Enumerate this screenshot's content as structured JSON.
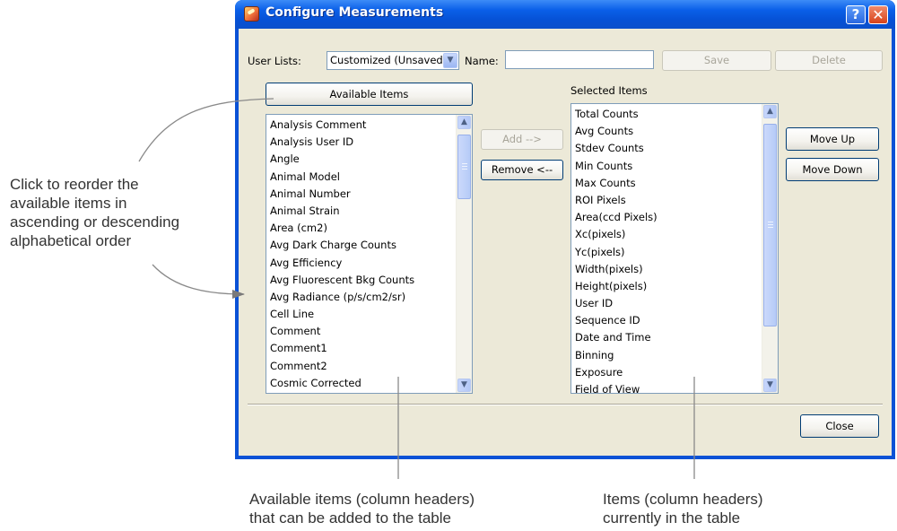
{
  "window": {
    "title": "Configure Measurements",
    "help_label": "?",
    "close_label": "✕"
  },
  "toolbar": {
    "user_lists_label": "User Lists:",
    "user_list_selected": "Customized (Unsaved)",
    "name_label": "Name:",
    "name_value": "",
    "save_label": "Save",
    "delete_label": "Delete"
  },
  "available": {
    "header_button": "Available Items",
    "items": [
      "Analysis Comment",
      "Analysis User ID",
      "Angle",
      "Animal Model",
      "Animal Number",
      "Animal Strain",
      "Area (cm2)",
      "Avg Dark Charge Counts",
      "Avg Efficiency",
      "Avg Fluorescent Bkg Counts",
      "Avg Radiance (p/s/cm2/sr)",
      "Cell Line",
      "Comment",
      "Comment1",
      "Comment2",
      "Cosmic Corrected"
    ]
  },
  "selected": {
    "header": "Selected Items",
    "items": [
      "Total Counts",
      "Avg Counts",
      "Stdev Counts",
      "Min Counts",
      "Max Counts",
      "ROI Pixels",
      "Area(ccd Pixels)",
      "Xc(pixels)",
      "Yc(pixels)",
      "Width(pixels)",
      "Height(pixels)",
      "User ID",
      "Sequence ID",
      "Date and Time",
      "Binning",
      "Exposure",
      "Field of View"
    ]
  },
  "actions": {
    "add_label": "Add   -->",
    "remove_label": "Remove <--",
    "move_up_label": "Move  Up",
    "move_down_label": "Move Down",
    "close_label": "Close"
  },
  "annotations": {
    "left_callout": [
      "Click to reorder the",
      "available items in",
      "ascending or descending",
      "alphabetical order"
    ],
    "available_callout": [
      "Available items (column headers)",
      "that can be added to the table"
    ],
    "selected_callout": [
      "Items (column headers)",
      "currently in the table"
    ]
  },
  "icons": {
    "app": "app-icon",
    "help": "help-icon",
    "close": "close-icon",
    "dropdown": "chevron-down-icon",
    "scroll_up": "scroll-up-icon",
    "scroll_down": "scroll-down-icon"
  }
}
